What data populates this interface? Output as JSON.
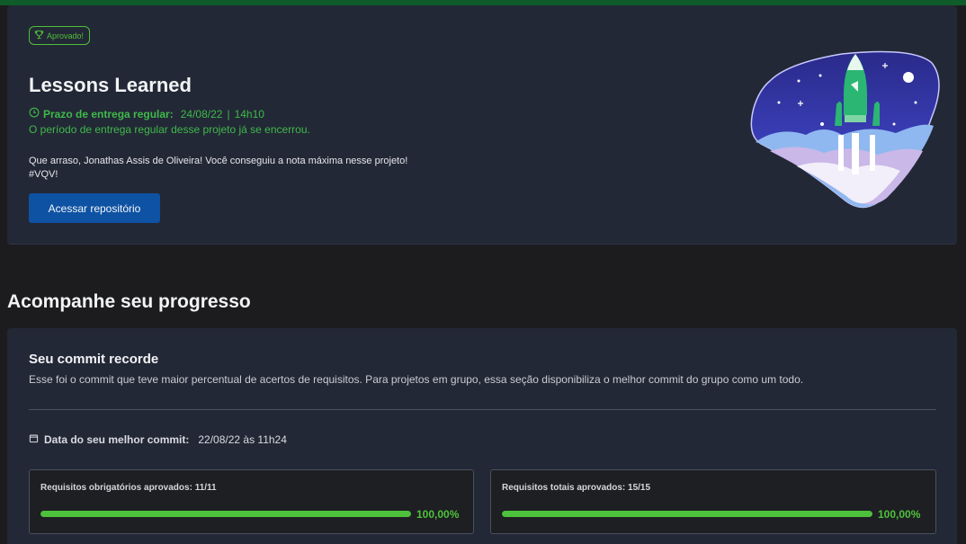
{
  "project": {
    "badge": "Aprovado!",
    "title": "Lessons Learned",
    "deadline_label": "Prazo de entrega regular:",
    "deadline_date": "24/08/22",
    "deadline_time": "14h10",
    "closed_message": "O período de entrega regular desse projeto já se encerrou.",
    "congrats_line1": "Que arraso, Jonathas Assis de Oliveira! Você conseguiu a nota máxima nesse projeto!",
    "congrats_line2": "#VQV!",
    "repo_button": "Acessar repositório"
  },
  "progress": {
    "section_title": "Acompanhe seu progresso",
    "commit_title": "Seu commit recorde",
    "commit_desc": "Esse foi o commit que teve maior percentual de acertos de requisitos. Para projetos em grupo, essa seção disponibiliza o melhor commit do grupo como um todo.",
    "best_commit_label": "Data do seu melhor commit:",
    "best_commit_value": "22/08/22 às 11h24",
    "required": {
      "label": "Requisitos obrigatórios aprovados: 11/11",
      "percent_text": "100,00%",
      "fraction": 1.0
    },
    "total": {
      "label": "Requisitos totais aprovados: 15/15",
      "percent_text": "100,00%",
      "fraction": 1.0
    }
  },
  "colors": {
    "accent_green": "#4ec13c",
    "button_blue": "#0e52a3",
    "card_bg": "#232836",
    "page_bg": "#1c1c1e"
  },
  "icons": {
    "badge": "trophy-icon",
    "deadline": "clock-icon",
    "best_commit": "calendar-icon"
  }
}
